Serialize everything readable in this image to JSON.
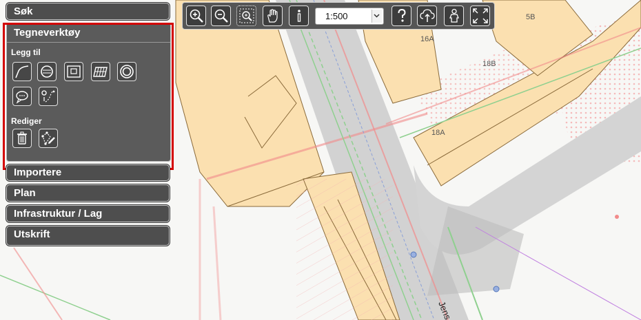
{
  "sidebar": {
    "sections": {
      "search": "Søk",
      "drawing_tools": "Tegneverktøy",
      "import": "Importere",
      "plan": "Plan",
      "infrastructure": "Infrastruktur / Lag",
      "print": "Utskrift"
    },
    "add_label": "Legg til",
    "edit_label": "Rediger",
    "add_tools": [
      "line-tool-icon",
      "circle-symbol-tool-icon",
      "frame-tool-icon",
      "grid-area-tool-icon",
      "ring-tool-icon",
      "comment-tool-icon",
      "measure-route-tool-icon"
    ],
    "edit_tools": [
      "delete-tool-icon",
      "edit-vertices-tool-icon"
    ],
    "highlight_color": "#d40000"
  },
  "toolbar": {
    "buttons": [
      "zoom-in-icon",
      "zoom-out-icon",
      "zoom-box-icon",
      "pan-hand-icon",
      "info-icon",
      "help-icon",
      "cloud-upload-icon",
      "person-icon",
      "fullscreen-icon"
    ],
    "scale_value": "1:500"
  },
  "map": {
    "address_labels": {
      "l16a": "16A",
      "l18a": "18A",
      "l18b": "18B",
      "l5b": "5B"
    },
    "street_name": "Jens B",
    "colors": {
      "building": "#fbe0b0",
      "road": "#cfcfcf",
      "pipe_red": "#f28b8b",
      "pipe_green": "#8fd08f"
    }
  }
}
